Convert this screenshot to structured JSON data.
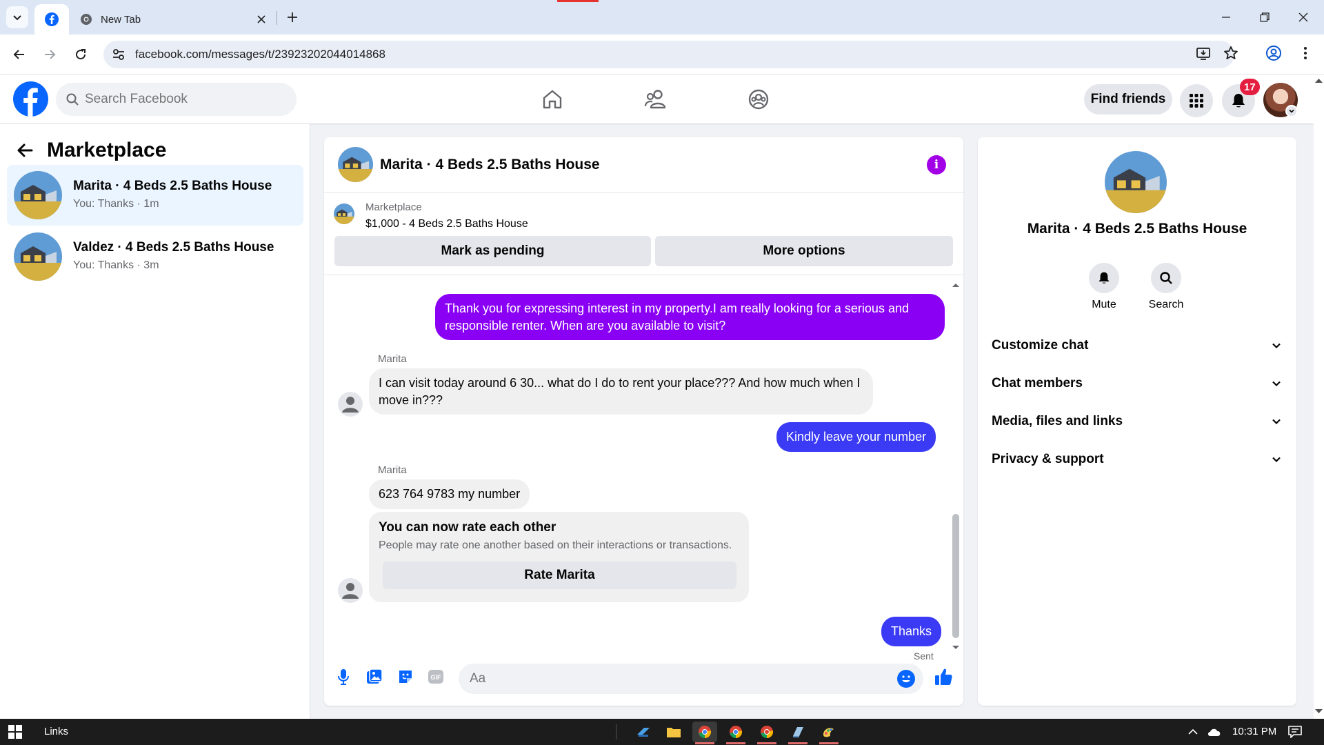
{
  "browser": {
    "tab_title": "New Tab",
    "url": "facebook.com/messages/t/23923202044014868"
  },
  "fb_header": {
    "search_placeholder": "Search Facebook",
    "find_friends_label": "Find friends",
    "notification_count": "17"
  },
  "left_panel": {
    "title": "Marketplace",
    "conversations": [
      {
        "name": "Marita · 4 Beds 2.5 Baths House",
        "snippet": "You: Thanks · 1m",
        "active": true
      },
      {
        "name": "Valdez · 4 Beds 2.5 Baths House",
        "snippet": "You: Thanks · 3m",
        "active": false
      }
    ]
  },
  "chat": {
    "title": "Marita · 4 Beds 2.5 Baths House",
    "marketplace_label": "Marketplace",
    "listing": "$1,000 - 4 Beds 2.5 Baths House",
    "mark_pending_label": "Mark as pending",
    "more_options_label": "More options",
    "messages": [
      {
        "from": "me",
        "text": "Thank you for expressing interest in my property.I am really looking for a serious and responsible renter. When are you available to visit?"
      },
      {
        "from": "Marita",
        "sender": "Marita",
        "text": "I can visit today around 6 30... what do I do to rent your place??? And how much when I move in???"
      },
      {
        "from": "me",
        "text": "Kindly leave your number"
      },
      {
        "from": "Marita",
        "sender": "Marita",
        "text": "623 764 9783 my number"
      },
      {
        "from": "me",
        "text": "Thanks",
        "status": "Sent"
      }
    ],
    "rate_card": {
      "title": "You can now rate each other",
      "subtitle": "People may rate one another based on their interactions or transactions.",
      "button_label": "Rate Marita"
    },
    "composer_placeholder": "Aa"
  },
  "right_panel": {
    "name": "Marita · 4 Beds 2.5 Baths House",
    "actions": [
      {
        "label": "Mute",
        "icon": "bell-icon"
      },
      {
        "label": "Search",
        "icon": "search-icon"
      }
    ],
    "sections": [
      {
        "label": "Customize chat"
      },
      {
        "label": "Chat members"
      },
      {
        "label": "Media, files and links"
      },
      {
        "label": "Privacy & support"
      }
    ]
  },
  "taskbar": {
    "links_label": "Links",
    "time": "10:31 PM"
  },
  "colors": {
    "outgoing_purple": "#8a00f5",
    "outgoing_blue": "#3b3bf5",
    "facebook_blue": "#0866ff",
    "info_purple": "#a200e6"
  }
}
